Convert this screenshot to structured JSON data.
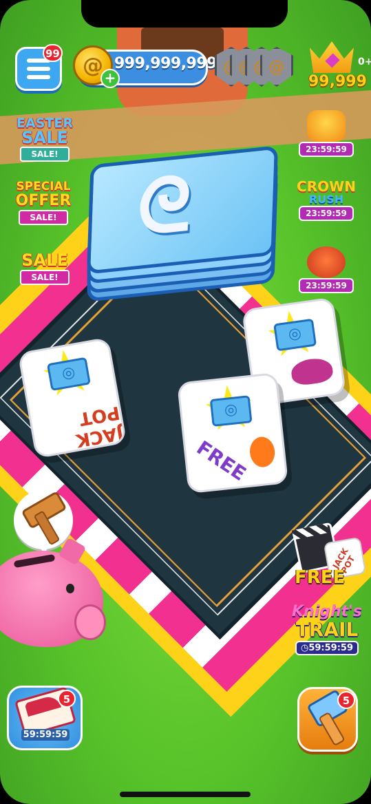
{
  "top_bar": {
    "menu_badge": "99",
    "coins": "999,999,999",
    "crown_count": "99,999",
    "crown_extra": "0+",
    "shield_icon": "spiral-shield-icon"
  },
  "left_events": [
    {
      "title_line1": "EASTER",
      "title_line2": "SALE",
      "ribbon": "SALE!"
    },
    {
      "title_line1": "SPECIAL",
      "title_line2": "OFFER",
      "ribbon": "SALE!"
    },
    {
      "title_line1": "SALE",
      "title_line2": "",
      "ribbon": "SALE!"
    }
  ],
  "right_timers": [
    {
      "time": "23:59:59"
    },
    {
      "title_line1": "CROWN",
      "title_line2": "RUSH",
      "time": "23:59:59"
    },
    {
      "time": "23:59:59"
    }
  ],
  "dice": {
    "jackpot_text": "JACK POT",
    "free_text": "FREE"
  },
  "free_jackpot": {
    "label": "FREE",
    "mini_die_text": "JACK POT"
  },
  "knights_trail": {
    "line1": "Knight's",
    "line2": "TRAIL",
    "time": "59:59:59"
  },
  "bottom": {
    "album_time": "59:59:59",
    "album_badge": "5",
    "hammer_badge": "5"
  },
  "colors": {
    "grass": "#57c22a",
    "board": "#1f3540",
    "accent_pink": "#f2308f",
    "accent_yellow": "#ffd21a",
    "button_blue": "#3da7f2"
  }
}
